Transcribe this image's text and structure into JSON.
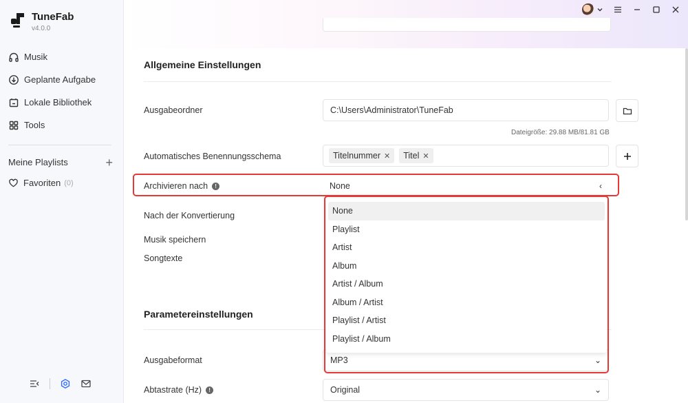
{
  "app": {
    "name": "TuneFab",
    "version": "v4.0.0"
  },
  "sidebar": {
    "items": [
      {
        "label": "Musik",
        "icon": "headphones-icon"
      },
      {
        "label": "Geplante Aufgabe",
        "icon": "download-icon"
      },
      {
        "label": "Lokale Bibliothek",
        "icon": "library-icon"
      },
      {
        "label": "Tools",
        "icon": "grid-icon"
      }
    ],
    "playlists_label": "Meine Playlists",
    "favorites_label": "Favoriten",
    "favorites_count": "(0)"
  },
  "settings": {
    "general_title": "Allgemeine Einstellungen",
    "output_folder_label": "Ausgabeordner",
    "output_folder_value": "C:\\Users\\Administrator\\TuneFab",
    "file_size": "Dateigröße: 29.88 MB/81.81 GB",
    "naming_label": "Automatisches Benennungsschema",
    "naming_tags": [
      "Titelnummer",
      "Titel"
    ],
    "archive_label": "Archivieren nach",
    "archive_value": "None",
    "after_conversion_label": "Nach der Konvertierung",
    "save_music_label": "Musik speichern",
    "lyrics_label": "Songtexte",
    "params_title": "Parametereinstellungen",
    "output_format_label": "Ausgabeformat",
    "output_format_value": "MP3",
    "sample_rate_label": "Abtastrate (Hz)",
    "sample_rate_value": "Original"
  },
  "archive_options": [
    "None",
    "Playlist",
    "Artist",
    "Album",
    "Artist / Album",
    "Album / Artist",
    "Playlist / Artist",
    "Playlist / Album"
  ],
  "colors": {
    "highlight_border": "#e53935",
    "accent": "#2f6bff"
  }
}
